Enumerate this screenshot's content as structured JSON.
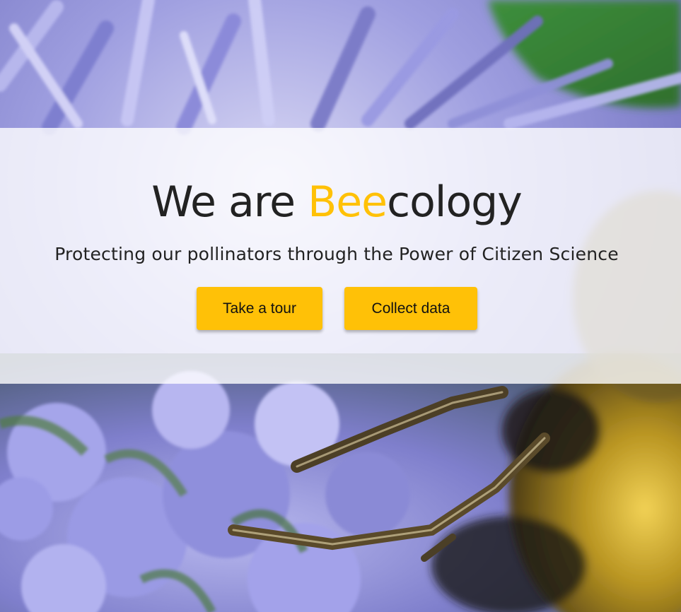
{
  "hero": {
    "headline_prefix": "We are ",
    "headline_accent": "Bee",
    "headline_suffix": "cology",
    "tagline": "Protecting our pollinators through the Power of Citizen Science",
    "background_icon": "bee-on-flower-photo"
  },
  "actions": {
    "tour_label": "Take a tour",
    "collect_label": "Collect data"
  },
  "colors": {
    "accent": "#ffc107",
    "text": "#222222",
    "overlay": "#ffffff",
    "flower": "#8f8fd6",
    "bee_yellow": "#c9a72a"
  }
}
